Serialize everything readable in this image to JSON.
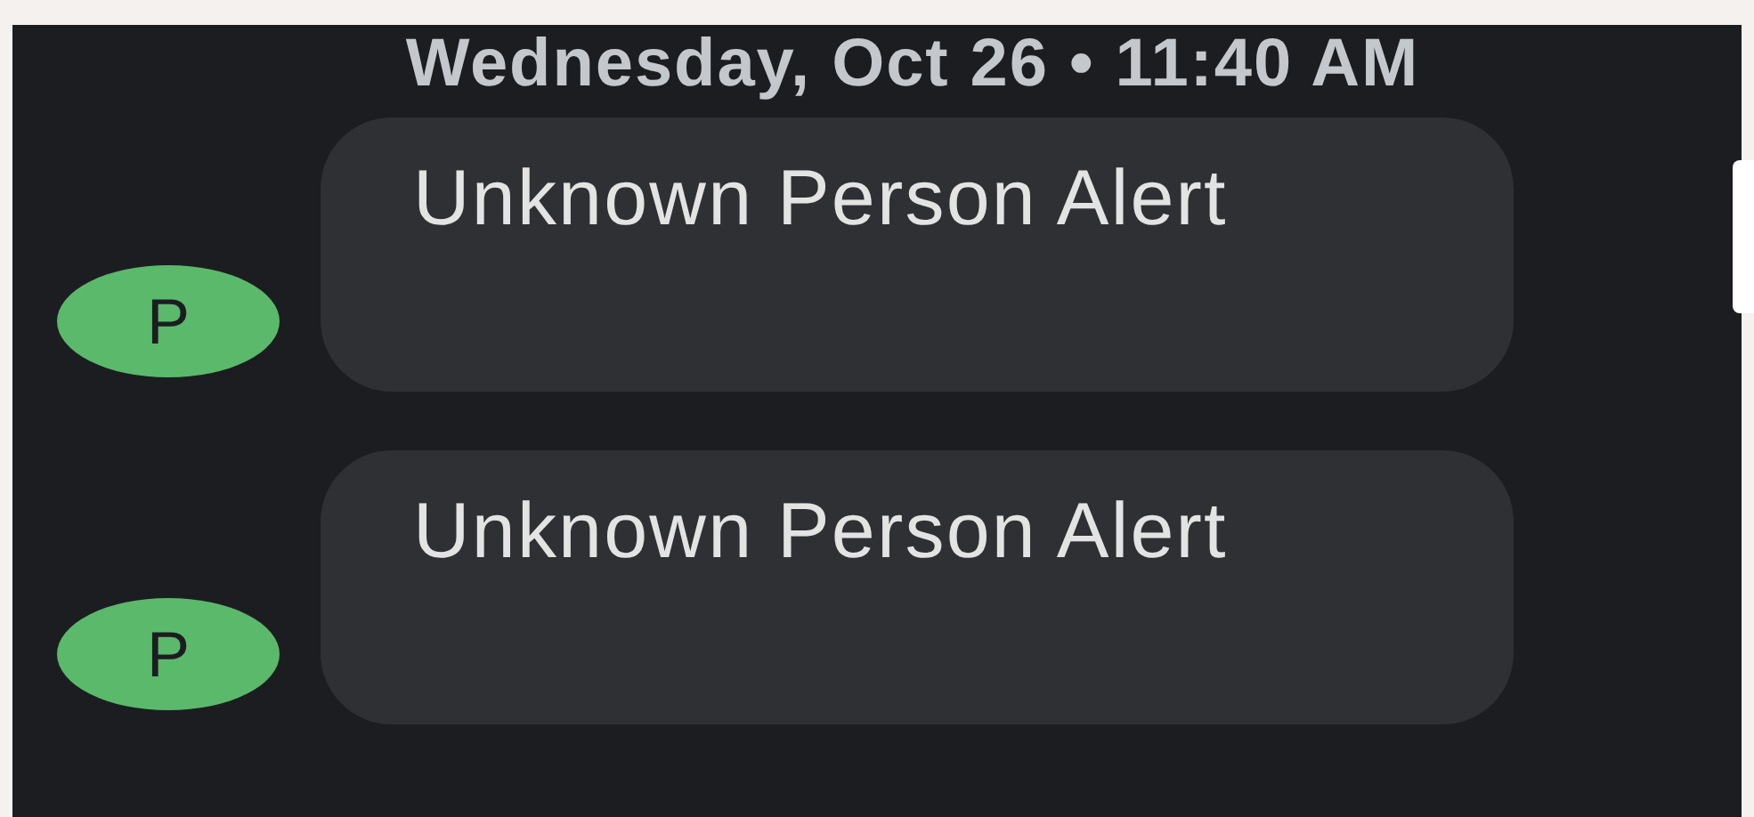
{
  "header": {
    "timestamp": "Wednesday, Oct 26 • 11:40 AM"
  },
  "messages": [
    {
      "avatar": "P",
      "color": "#5bb96b",
      "text": "Unknown Person Alert"
    },
    {
      "avatar": "P",
      "color": "#5bb96b",
      "text": "Unknown Person Alert"
    }
  ]
}
